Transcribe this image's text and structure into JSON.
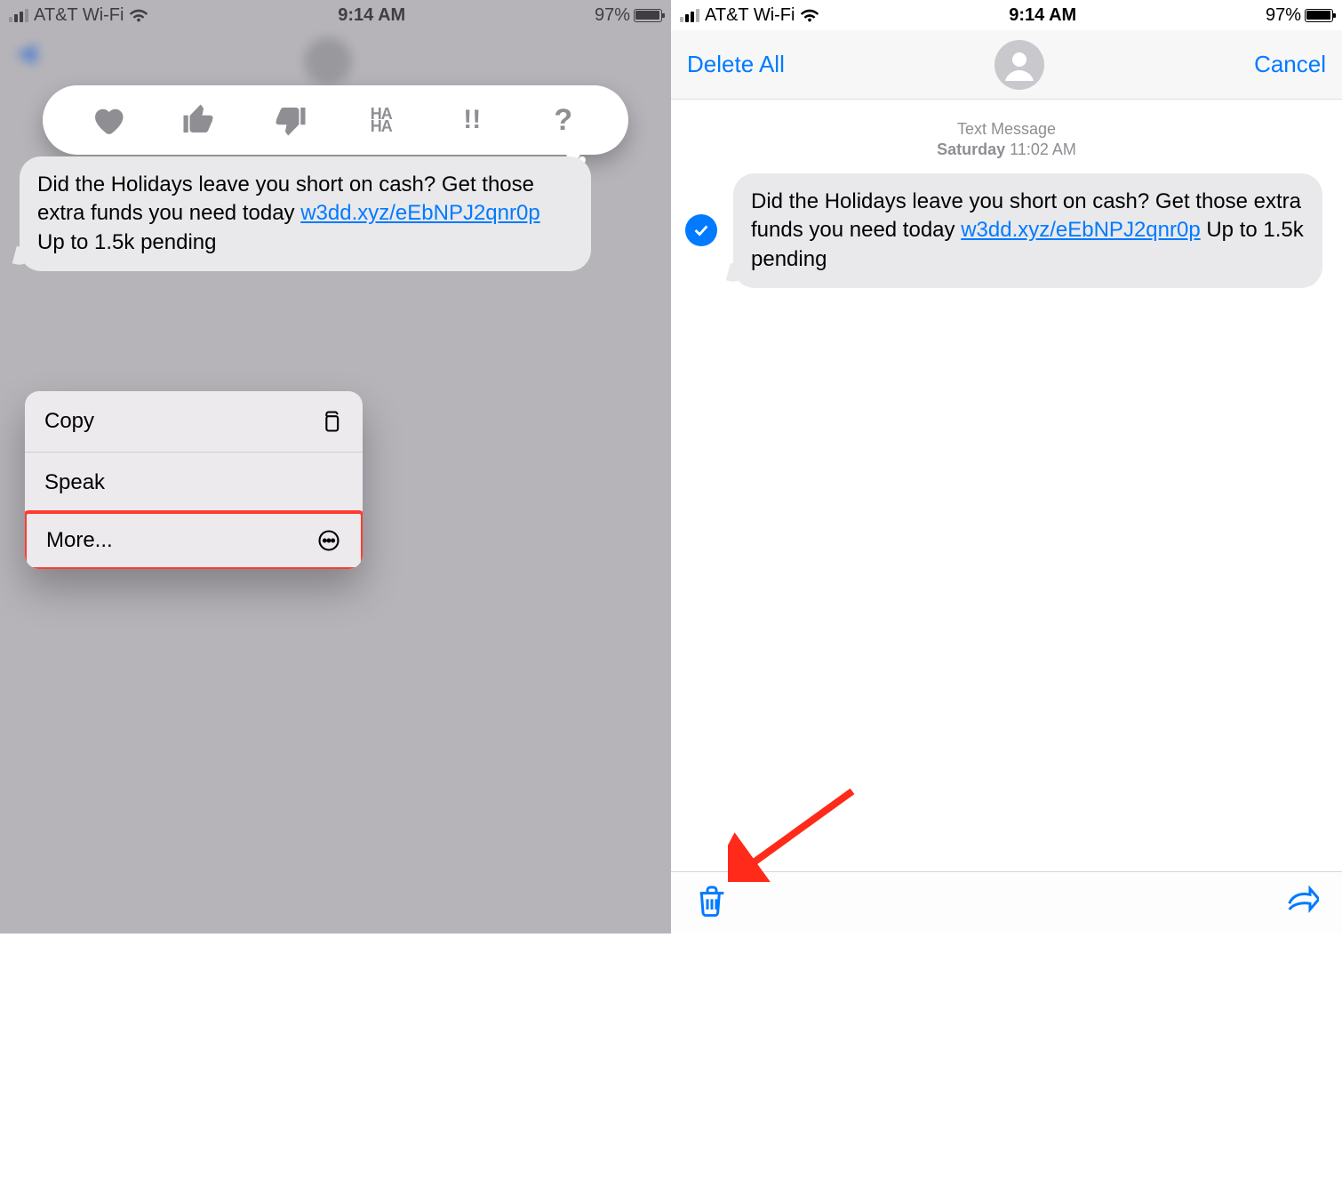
{
  "status": {
    "carrier": "AT&T Wi-Fi",
    "time": "9:14 AM",
    "battery_pct": "97%"
  },
  "left": {
    "message": {
      "text_before_link": "Did the Holidays leave you short on cash? Get those extra funds you need today ",
      "link": "w3dd.xyz/eEbNPJ2qnr0p",
      "text_after_link": " Up to 1.5k pending"
    },
    "tapbacks": {
      "heart": "heart-icon",
      "thumbs_up": "thumbs-up-icon",
      "thumbs_down": "thumbs-down-icon",
      "haha": "HA HA",
      "exclaim": "!!",
      "question": "?"
    },
    "menu": {
      "copy": "Copy",
      "speak": "Speak",
      "more": "More..."
    }
  },
  "right": {
    "nav": {
      "delete_all": "Delete All",
      "cancel": "Cancel"
    },
    "meta": {
      "kind": "Text Message",
      "day": "Saturday",
      "time": "11:02 AM"
    },
    "message": {
      "text_before_link": "Did the Holidays leave you short on cash? Get those extra funds you need today ",
      "link": "w3dd.xyz/eEbNPJ2qnr0p",
      "text_after_link": " Up to 1.5k pending"
    }
  }
}
